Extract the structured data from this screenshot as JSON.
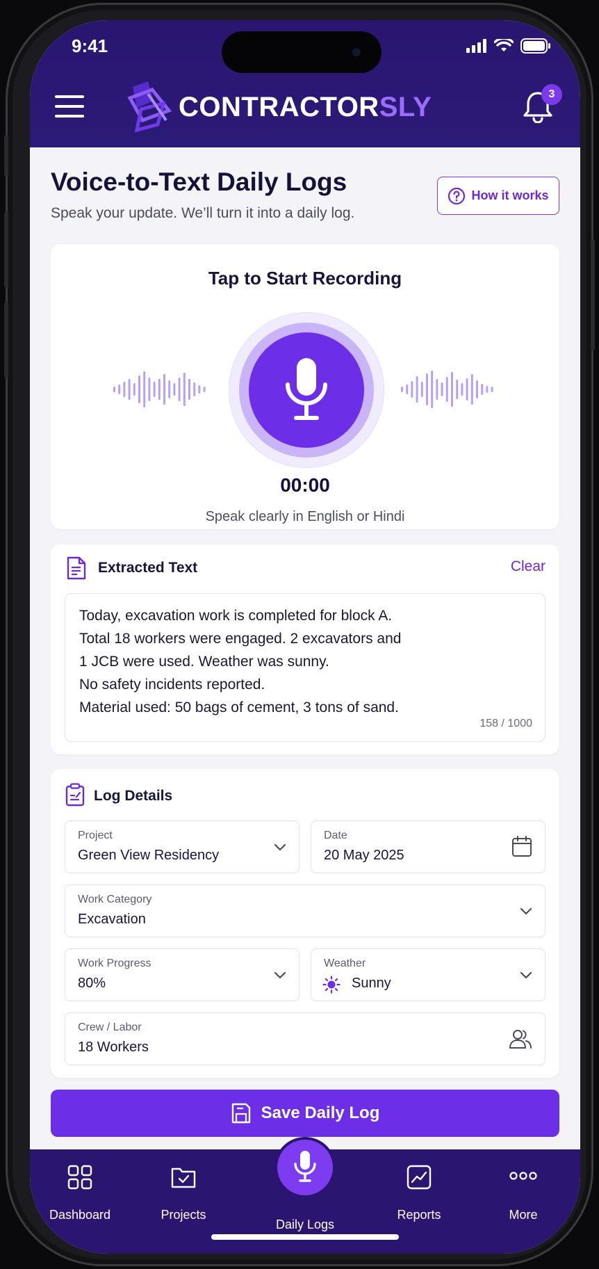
{
  "status_bar": {
    "time": "9:41"
  },
  "header": {
    "brand_main": "CONTRACTOR",
    "brand_accent": "SLY",
    "notification_count": "3",
    "icons": [
      "menu-icon",
      "logo-icon",
      "bell-icon"
    ]
  },
  "page": {
    "title": "Voice-to-Text Daily Logs",
    "subtitle": "Speak your update. We’ll turn it into a daily log.",
    "how_it_works_label": "How it works"
  },
  "recorder": {
    "title": "Tap to Start Recording",
    "timer": "00:00",
    "hint": "Speak clearly in English or Hindi",
    "icon": "microphone-icon"
  },
  "extracted_text": {
    "title": "Extracted Text",
    "clear_label": "Clear",
    "lines": [
      "Today, excavation work is completed for block A.",
      "Total 18 workers were engaged. 2 excavators and",
      "1 JCB were used. Weather was sunny.",
      "No safety incidents reported.",
      "Material used: 50 bags of cement, 3 tons of sand."
    ],
    "counter": "158 / 1000"
  },
  "log_details": {
    "title": "Log Details",
    "fields": {
      "project": {
        "label": "Project",
        "value": "Green View Residency"
      },
      "date": {
        "label": "Date",
        "value": "20 May 2025"
      },
      "work_category": {
        "label": "Work Category",
        "value": "Excavation"
      },
      "work_progress": {
        "label": "Work Progress",
        "value": "80%"
      },
      "weather": {
        "label": "Weather",
        "value": "Sunny"
      },
      "crew": {
        "label": "Crew / Labor",
        "value": "18 Workers"
      }
    }
  },
  "save_button": {
    "label": "Save Daily Log"
  },
  "tabbar": {
    "tabs": [
      {
        "label": "Dashboard",
        "icon": "grid-icon"
      },
      {
        "label": "Projects",
        "icon": "folder-check-icon"
      },
      {
        "label": "Daily Logs",
        "icon": "microphone-icon"
      },
      {
        "label": "Reports",
        "icon": "chart-icon"
      },
      {
        "label": "More",
        "icon": "more-dots-icon"
      }
    ]
  },
  "colors": {
    "primary": "#6d2ee8",
    "header_bg": "#2a1670",
    "accent_text": "#9a6cff"
  }
}
